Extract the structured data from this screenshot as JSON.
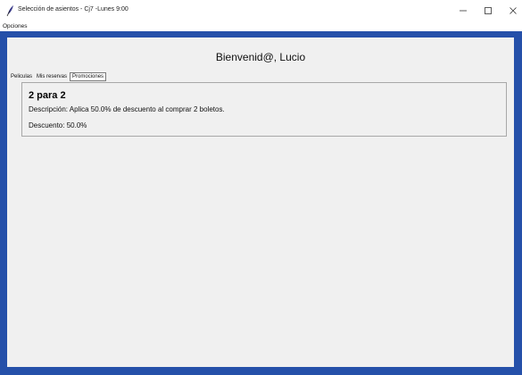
{
  "window": {
    "title": "Selección de asientos - Cj7 -Lunes 9:00",
    "icon": "feather-icon",
    "controls": [
      "minimize-icon",
      "maximize-icon",
      "close-icon"
    ]
  },
  "menubar": {
    "items": [
      "Opciones"
    ]
  },
  "main": {
    "welcome": "Bienvenid@, Lucio",
    "tabs": [
      {
        "label": "Peliculas",
        "active": false
      },
      {
        "label": "Mis reservas",
        "active": false
      },
      {
        "label": "Promociones",
        "active": true
      }
    ],
    "promotions": [
      {
        "name": "2 para 2",
        "description": "Descripción: Aplica 50.0% de descuento al comprar 2 boletos.",
        "discount": "Descuento: 50.0%"
      }
    ]
  },
  "colors": {
    "frame": "#2550a9",
    "panel": "#f0f0f0"
  }
}
